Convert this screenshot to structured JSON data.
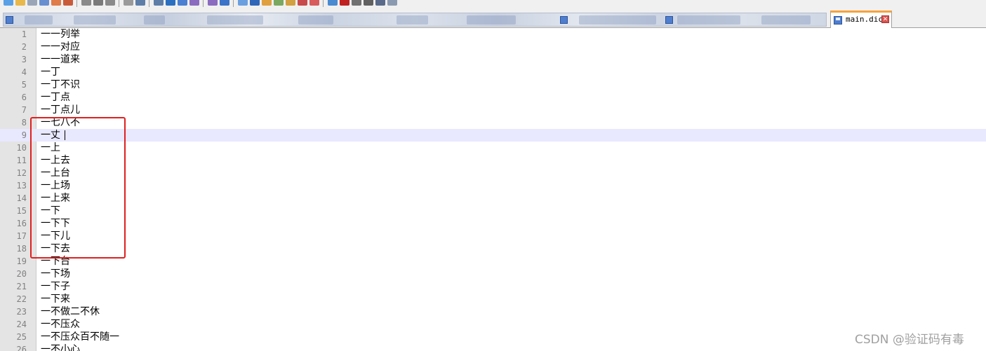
{
  "window": {
    "active_tab": "main.dic",
    "close_glyph": "✕"
  },
  "toolbar": {
    "icons": [
      "new-file-icon",
      "open-file-icon",
      "save-icon",
      "save-all-icon",
      "close-icon",
      "close-all-icon",
      "print-icon",
      "cut-icon",
      "copy-icon",
      "paste-icon",
      "undo-icon",
      "redo-icon",
      "find-icon",
      "replace-icon",
      "zoom-in-icon",
      "zoom-out-icon",
      "sync-v-icon",
      "sync-h-icon",
      "word-wrap-icon",
      "all-chars-icon",
      "indent-guide-icon",
      "udl-icon",
      "doc-map-icon",
      "function-list-icon",
      "folder-workspace-icon",
      "record-macro-icon",
      "stop-macro-icon",
      "play-macro-icon",
      "run-macro-icon",
      "save-macro-icon"
    ],
    "colors": {
      "accent": "#f7a23a",
      "blue": "#4f7ecf",
      "red": "#d9534f"
    }
  },
  "editor": {
    "current_line": 9,
    "lines": [
      {
        "n": "1",
        "text": "一一列举"
      },
      {
        "n": "2",
        "text": "一一对应"
      },
      {
        "n": "3",
        "text": "一一道来"
      },
      {
        "n": "4",
        "text": "一丁"
      },
      {
        "n": "5",
        "text": "一丁不识"
      },
      {
        "n": "6",
        "text": "一丁点"
      },
      {
        "n": "7",
        "text": "一丁点儿"
      },
      {
        "n": "8",
        "text": "一七八不"
      },
      {
        "n": "9",
        "text": "一丈"
      },
      {
        "n": "10",
        "text": "一上"
      },
      {
        "n": "11",
        "text": "一上去"
      },
      {
        "n": "12",
        "text": "一上台"
      },
      {
        "n": "13",
        "text": "一上场"
      },
      {
        "n": "14",
        "text": "一上来"
      },
      {
        "n": "15",
        "text": "一下"
      },
      {
        "n": "16",
        "text": "一下下"
      },
      {
        "n": "17",
        "text": "一下儿"
      },
      {
        "n": "18",
        "text": "一下去"
      },
      {
        "n": "19",
        "text": "一下台"
      },
      {
        "n": "20",
        "text": "一下场"
      },
      {
        "n": "21",
        "text": "一下子"
      },
      {
        "n": "22",
        "text": "一下来"
      },
      {
        "n": "23",
        "text": "一不做二不休"
      },
      {
        "n": "24",
        "text": "一不压众"
      },
      {
        "n": "25",
        "text": "一不压众百不随一"
      },
      {
        "n": "26",
        "text": "一不小心"
      }
    ]
  },
  "annotation": {
    "color": "#e02020"
  },
  "watermark": "CSDN @验证码有毒"
}
